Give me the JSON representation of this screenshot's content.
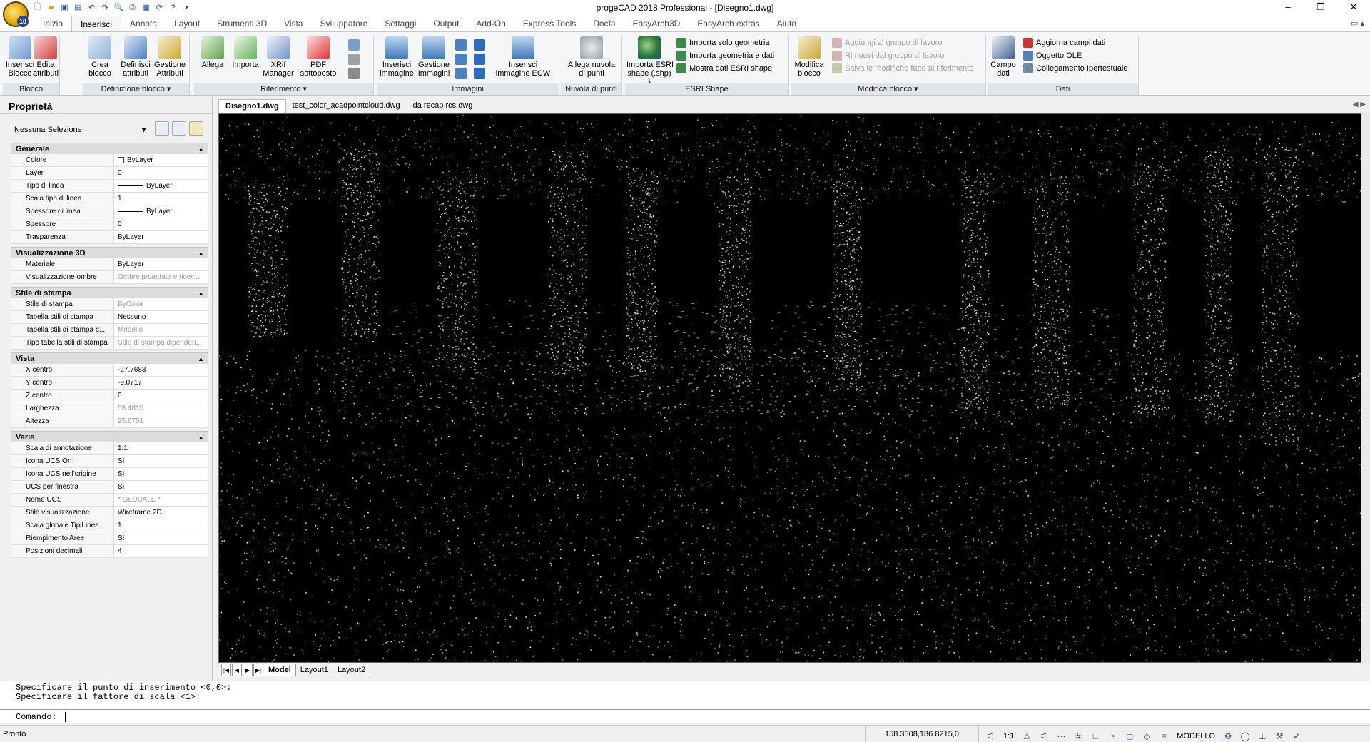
{
  "app": {
    "title": "progeCAD 2018 Professional - [Disegno1.dwg]",
    "badge": "18"
  },
  "window_controls": {
    "minimize": "–",
    "maximize": "❐",
    "close": "✕"
  },
  "ribbon_tabs": [
    "Inizio",
    "Inserisci",
    "Annota",
    "Layout",
    "Strumenti 3D",
    "Vista",
    "Sviluppatore",
    "Settaggi",
    "Output",
    "Add-On",
    "Express Tools",
    "Docfa",
    "EasyArch3D",
    "EasyArch extras",
    "Aiuto"
  ],
  "ribbon": {
    "blocco": {
      "label": "Blocco",
      "inserisci": "Inserisci\nBlocco",
      "edita": "Edita\nattributi"
    },
    "definizione": {
      "label": "Definizione blocco ▾",
      "crea": "Crea\nblocco",
      "definisci": "Definisci\nattributi",
      "gestione": "Gestione\nAttributi"
    },
    "riferimento": {
      "label": "Riferimento ▾",
      "allega": "Allega",
      "importa": "Importa",
      "xrif": "XRif\nManager",
      "pdf": "PDF\nsottoposto"
    },
    "immagini": {
      "label": "Immagini",
      "inserisci": "Inserisci\nimmagine",
      "gestione": "Gestione\nImmagini",
      "ecw": "Inserisci\nimmagine ECW"
    },
    "nuvola": {
      "label": "Nuvola di punti",
      "allega": "Allega nuvola\ndi punti"
    },
    "esri": {
      "label": "ESRI Shape",
      "importa": "Importa ESRI\nshape (.shp)",
      "solo": "Importa solo geometria",
      "geomdati": "Importa geometria e dati",
      "mostra": "Mostra dati ESRI shape"
    },
    "modifica": {
      "label": "Modifica blocco ▾",
      "modifica": "Modifica\nblocco",
      "aggiungi": "Aggiungi al gruppo di lavoro",
      "rimuovi": "Rimuovi dal gruppo di lavoro",
      "salva": "Salva le modifiche fatte al riferimento"
    },
    "dati": {
      "label": "Dati",
      "campo": "Campo\ndati",
      "aggiorna": "Aggiorna campi dati",
      "ole": "Oggetto OLE",
      "collegamento": "Collegamento Ipertestuale"
    }
  },
  "properties": {
    "title": "Proprietà",
    "selection": "Nessuna Selezione",
    "sections": [
      {
        "name": "Generale",
        "rows": [
          {
            "k": "Colore",
            "v": "ByLayer",
            "ico": "box"
          },
          {
            "k": "Layer",
            "v": "0"
          },
          {
            "k": "Tipo di linea",
            "v": "ByLayer",
            "ico": "line"
          },
          {
            "k": "Scala tipo di linea",
            "v": "1"
          },
          {
            "k": "Spessore di linea",
            "v": "ByLayer",
            "ico": "line"
          },
          {
            "k": "Spessore",
            "v": "0"
          },
          {
            "k": "Trasparenza",
            "v": "ByLayer"
          }
        ]
      },
      {
        "name": "Visualizzazione 3D",
        "rows": [
          {
            "k": "Materiale",
            "v": "ByLayer"
          },
          {
            "k": "Visualizzazione ombre",
            "v": "Ombre proiettate e ricev...",
            "gray": true
          }
        ]
      },
      {
        "name": "Stile di stampa",
        "rows": [
          {
            "k": "Stile di stampa",
            "v": "ByColor",
            "gray": true
          },
          {
            "k": "Tabella stili di stampa",
            "v": "Nessuno"
          },
          {
            "k": "Tabella stili di stampa c...",
            "v": "Modello",
            "gray": true
          },
          {
            "k": "Tipo tabella stili di stampa",
            "v": "Stile di stampa dipenden...",
            "gray": true
          }
        ]
      },
      {
        "name": "Vista",
        "rows": [
          {
            "k": "X centro",
            "v": "-27.7683"
          },
          {
            "k": "Y centro",
            "v": "-9.0717"
          },
          {
            "k": "Z centro",
            "v": "0"
          },
          {
            "k": "Larghezza",
            "v": "53.4815",
            "gray": true
          },
          {
            "k": "Altezza",
            "v": "25.6751",
            "gray": true
          }
        ]
      },
      {
        "name": "Varie",
        "rows": [
          {
            "k": "Scala di annotazione",
            "v": "1:1"
          },
          {
            "k": "Icona UCS On",
            "v": "Sì"
          },
          {
            "k": "Icona UCS nell'origine",
            "v": "Sì"
          },
          {
            "k": "UCS per finestra",
            "v": "Sì"
          },
          {
            "k": "Nome UCS",
            "v": "* GLOBALE *",
            "gray": true
          },
          {
            "k": "Stile visualizzazione",
            "v": "Wireframe 2D"
          },
          {
            "k": "Scala globale TipiLinea",
            "v": "1"
          },
          {
            "k": "Riempimento Aree",
            "v": "Sì"
          },
          {
            "k": "Posizioni decimali",
            "v": "4"
          }
        ]
      }
    ]
  },
  "doc_tabs": [
    "Disegno1.dwg",
    "test_color_acadpointcloud.dwg",
    "da recap rcs.dwg"
  ],
  "layout_tabs": [
    "Model",
    "Layout1",
    "Layout2"
  ],
  "command": {
    "history": [
      "Specificare il punto di inserimento <0,0>:",
      "Specificare il fattore di scala <1>:"
    ],
    "prompt": "Comando:"
  },
  "status": {
    "text": "Pronto",
    "coords": "158.3508,186.8215,0",
    "scale": "1:1",
    "mode": "MODELLO"
  },
  "colors": {
    "accent": "#2a5db0",
    "viewport_bg": "#000000",
    "ribbon_bg": "#f5f6f7"
  }
}
